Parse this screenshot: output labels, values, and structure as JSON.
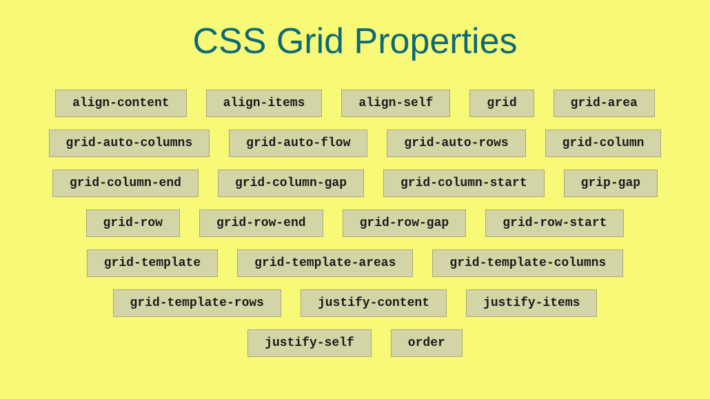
{
  "title": "CSS Grid Properties",
  "rows": [
    [
      "align-content",
      "align-items",
      "align-self",
      "grid",
      "grid-area"
    ],
    [
      "grid-auto-columns",
      "grid-auto-flow",
      "grid-auto-rows",
      "grid-column"
    ],
    [
      "grid-column-end",
      "grid-column-gap",
      "grid-column-start",
      "grip-gap"
    ],
    [
      "grid-row",
      "grid-row-end",
      "grid-row-gap",
      "grid-row-start"
    ],
    [
      "grid-template",
      "grid-template-areas",
      "grid-template-columns"
    ],
    [
      "grid-template-rows",
      "justify-content",
      "justify-items"
    ],
    [
      "justify-self",
      "order"
    ]
  ]
}
